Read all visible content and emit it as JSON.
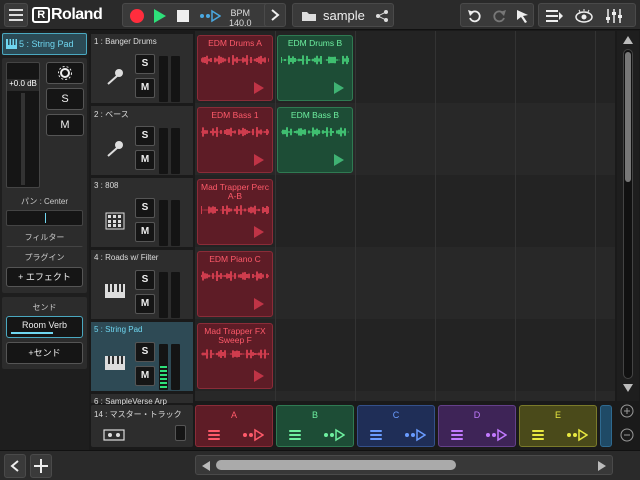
{
  "topbar": {
    "brand": "Roland",
    "bpm_label": "BPM",
    "bpm_value": "140.0",
    "song_name": "sample",
    "icons": [
      "menu-icon",
      "record-icon",
      "play-icon",
      "stop-icon",
      "loop-icon",
      "chevron-right-icon",
      "folder-icon",
      "share-icon",
      "undo-icon",
      "redo-icon",
      "pointer-icon",
      "list-icon",
      "eye-icon",
      "mixer-icon"
    ]
  },
  "inspector": {
    "title": "5 : String Pad",
    "volume": "+0.0 dB",
    "solo": "S",
    "mute": "M",
    "pan_label": "パン : Center",
    "filter_label": "フィルター",
    "plugin_label": "プラグイン",
    "add_effect": "+ エフェクト",
    "send_label": "センド",
    "send_item": "Room Verb",
    "add_send": "+センド"
  },
  "tracks": [
    {
      "name": "1 : Banger Drums",
      "icon": "mic-icon",
      "solo": "S",
      "mute": "M"
    },
    {
      "name": "2 : ベース",
      "icon": "mic-icon",
      "solo": "S",
      "mute": "M"
    },
    {
      "name": "3 : 808",
      "icon": "drum-pad-icon",
      "solo": "S",
      "mute": "M"
    },
    {
      "name": "4 : Roads w/ Filter",
      "icon": "keyboard-icon",
      "solo": "S",
      "mute": "M"
    },
    {
      "name": "5 : String Pad",
      "icon": "keyboard-icon",
      "solo": "S",
      "mute": "M"
    },
    {
      "name": "6 : SampleVerse Arp",
      "icon": "keyboard-icon",
      "solo": "S",
      "mute": "M"
    }
  ],
  "clips": [
    {
      "name": "EDM Drums A",
      "color": "red",
      "row": 0,
      "col": 0
    },
    {
      "name": "EDM Drums B",
      "color": "green",
      "row": 0,
      "col": 1
    },
    {
      "name": "EDM Bass 1",
      "color": "red",
      "row": 1,
      "col": 0
    },
    {
      "name": "EDM Bass B",
      "color": "green",
      "row": 1,
      "col": 1
    },
    {
      "name": "Mad Trapper Perc A-B",
      "color": "red",
      "row": 2,
      "col": 0
    },
    {
      "name": "EDM Piano C",
      "color": "red",
      "row": 3,
      "col": 0
    },
    {
      "name": "Mad Trapper FX Sweep F",
      "color": "red",
      "row": 4,
      "col": 0
    }
  ],
  "master": {
    "name": "14 : マスター・トラック"
  },
  "scenes": [
    {
      "name": "A",
      "bg": "#5e1c26",
      "border": "#8a2c38",
      "fg": "#ff5a6a"
    },
    {
      "name": "B",
      "bg": "#1d4d36",
      "border": "#2f7a52",
      "fg": "#6ef0a0"
    },
    {
      "name": "C",
      "bg": "#1f2e57",
      "border": "#34508a",
      "fg": "#6a9cff"
    },
    {
      "name": "D",
      "bg": "#3e2457",
      "border": "#64408a",
      "fg": "#c27aff"
    },
    {
      "name": "E",
      "bg": "#4a4a1a",
      "border": "#7a7a2a",
      "fg": "#e8e840"
    }
  ],
  "colors": {
    "accent": "#6fd6f0",
    "record": "#ff2d3d",
    "play": "#2ee07a"
  }
}
